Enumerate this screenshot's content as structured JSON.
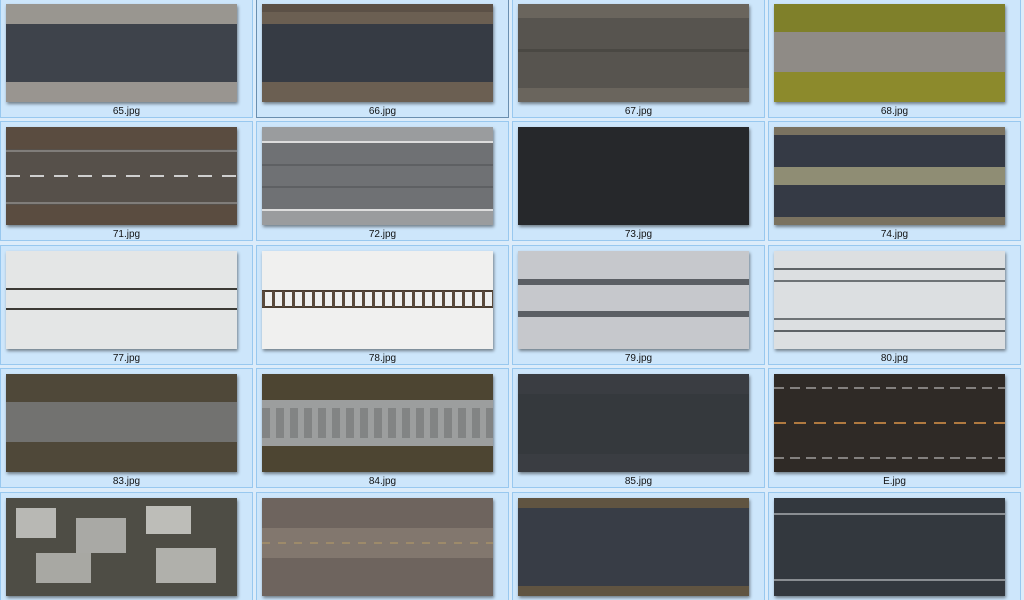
{
  "files": [
    {
      "name": "65.jpg",
      "texture": "asphalt-gravel"
    },
    {
      "name": "66.jpg",
      "texture": "asphalt-dirt"
    },
    {
      "name": "67.jpg",
      "texture": "worn-asphalt"
    },
    {
      "name": "68.jpg",
      "texture": "grass-concrete"
    },
    {
      "name": "71.jpg",
      "texture": "dashed-road"
    },
    {
      "name": "72.jpg",
      "texture": "concrete-lanes"
    },
    {
      "name": "73.jpg",
      "texture": "dark-asphalt"
    },
    {
      "name": "74.jpg",
      "texture": "asphalt-grass-strip"
    },
    {
      "name": "77.jpg",
      "texture": "snow-rails"
    },
    {
      "name": "78.jpg",
      "texture": "snow-railway"
    },
    {
      "name": "79.jpg",
      "texture": "snow-tracks"
    },
    {
      "name": "80.jpg",
      "texture": "snow-road-lines"
    },
    {
      "name": "83.jpg",
      "texture": "gravel-path"
    },
    {
      "name": "84.jpg",
      "texture": "cobblestone-path"
    },
    {
      "name": "85.jpg",
      "texture": "dark-grunge"
    },
    {
      "name": "E.jpg",
      "texture": "dark-road-dashed"
    },
    {
      "name": "",
      "texture": "cracked-stone"
    },
    {
      "name": "",
      "texture": "dirt-road"
    },
    {
      "name": "",
      "texture": "asphalt-dirt-edges"
    },
    {
      "name": "",
      "texture": "dark-asphalt-lines"
    }
  ],
  "selected_index": 1,
  "colors": {
    "background": "#dcecfa",
    "cell": "#cde6fb",
    "cell_border": "#98c8ef"
  }
}
